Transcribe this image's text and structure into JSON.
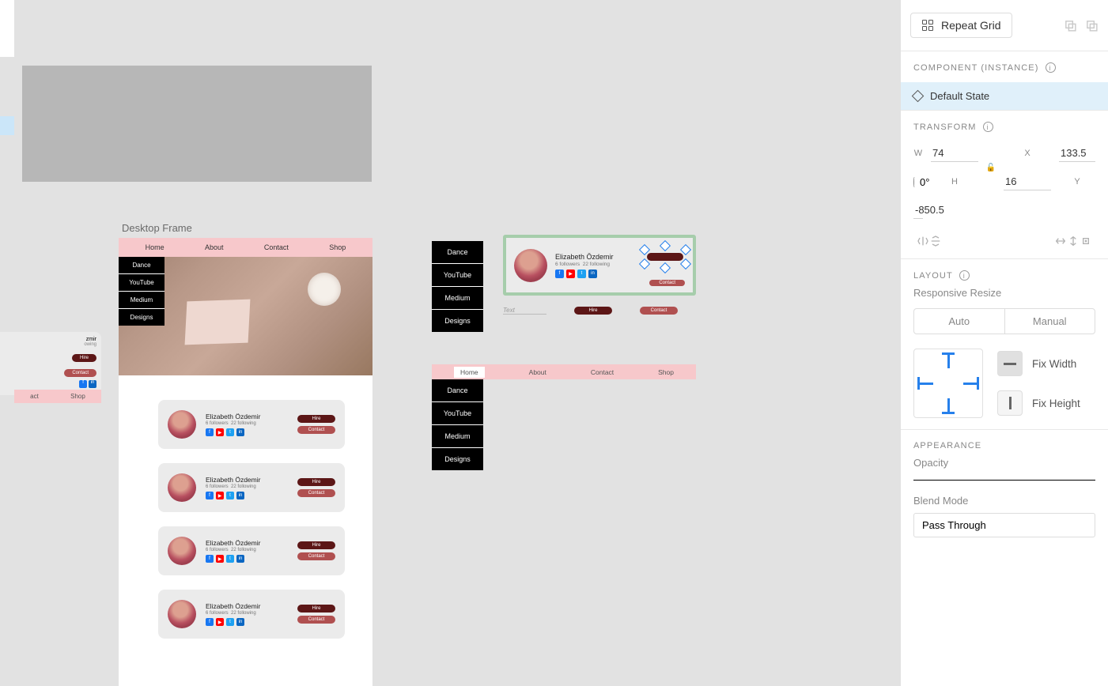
{
  "canvas": {
    "desktop_frame_label": "Desktop Frame",
    "nav_items": [
      "Home",
      "About",
      "Contact",
      "Shop"
    ],
    "menu_items": [
      "Dance",
      "YouTube",
      "Medium",
      "Designs"
    ],
    "profile_name": "Elizabeth Özdemir",
    "followers_text": "6 followers",
    "following_text": "22 following",
    "hire_label": "Hire",
    "contact_label": "Contact",
    "text_placeholder": "Text",
    "partial_name_suffix": "zmir",
    "partial_stat_suffix": "owing",
    "partial_nav": [
      "act",
      "Shop"
    ]
  },
  "panel": {
    "repeat_grid": "Repeat Grid",
    "component_section": "COMPONENT (INSTANCE)",
    "default_state": "Default State",
    "transform_section": "TRANSFORM",
    "w_label": "W",
    "w_val": "74",
    "h_label": "H",
    "h_val": "16",
    "x_label": "X",
    "x_val": "133.5",
    "y_label": "Y",
    "y_val": "-850.5",
    "rotation": "0°",
    "layout_section": "LAYOUT",
    "responsive_resize": "Responsive Resize",
    "auto_tab": "Auto",
    "manual_tab": "Manual",
    "fix_width": "Fix Width",
    "fix_height": "Fix Height",
    "appearance_section": "APPEARANCE",
    "opacity_label": "Opacity",
    "blend_mode_label": "Blend Mode",
    "blend_mode_value": "Pass Through"
  }
}
